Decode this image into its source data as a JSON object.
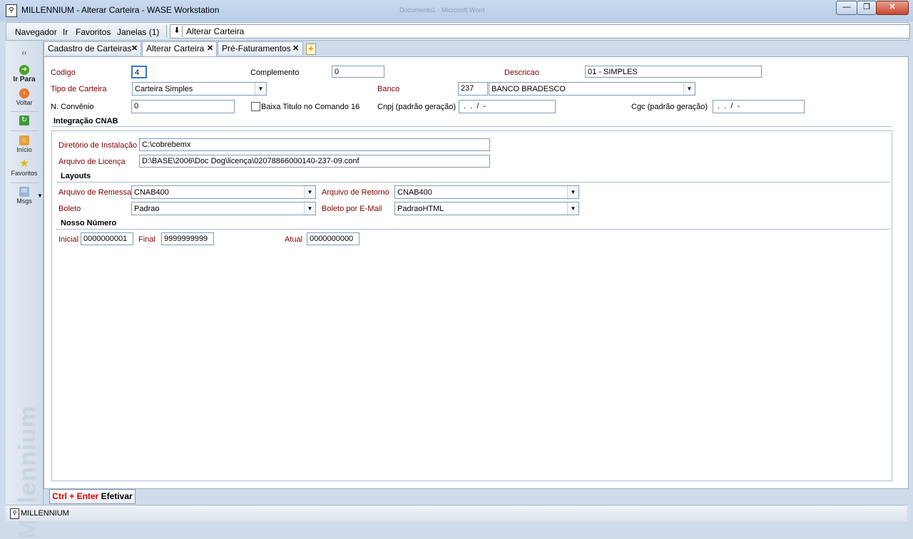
{
  "window": {
    "title": "MILLENNIUM - Alterar Carteira - WASE Workstation",
    "ghost_title": "Documento1 - Microsoft Word",
    "minimize": "—",
    "restore": "❐",
    "close": "✕"
  },
  "menu": {
    "items": [
      "Navegador",
      "Ir",
      "Favoritos",
      "Janelas (1)"
    ],
    "nav_arrow": "⬇",
    "nav_text": "Alterar Carteira"
  },
  "sidebar": {
    "collapse": "‹‹",
    "items": [
      {
        "label": "Ir Para",
        "icon": "go-arrow-icon"
      },
      {
        "label": "Voltar",
        "icon": "back-icon"
      },
      {
        "label": "",
        "icon": "refresh-icon"
      },
      {
        "label": "Início",
        "icon": "home-icon"
      },
      {
        "label": "Favoritos",
        "icon": "star-icon"
      },
      {
        "label": "Msgs",
        "icon": "messages-icon"
      }
    ],
    "watermark": "Millennium"
  },
  "tabs": [
    {
      "label": "Cadastro de Carteiras",
      "active": false
    },
    {
      "label": "Alterar Carteira",
      "active": true
    },
    {
      "label": "Pré-Faturamentos",
      "active": false
    }
  ],
  "form": {
    "codigo": {
      "label": "Codigo",
      "value": "4"
    },
    "complemento": {
      "label": "Complemento",
      "value": "0"
    },
    "descricao": {
      "label": "Descricao",
      "value": "01 - SIMPLES"
    },
    "tipo_carteira": {
      "label": "Tipo de Carteira",
      "value": "Carteira Simples"
    },
    "banco": {
      "label": "Banco",
      "code": "237",
      "name": "BANCO BRADESCO"
    },
    "convenio": {
      "label": "N. Convênio",
      "value": "0"
    },
    "baixa_titulo": {
      "label": "Baixa Titulo no Comando 16",
      "checked": false
    },
    "cnpj": {
      "label": "Cnpj (padrão geração)",
      "value": " .  .  /  -"
    },
    "cgc": {
      "label": "Cgc (padrão geração)",
      "value": " .  .  /  -"
    }
  },
  "cnab": {
    "section_title": "Integração CNAB",
    "diretorio": {
      "label": "Diretório de Instalação",
      "value": "C:\\cobrebemx"
    },
    "licenca": {
      "label": "Arquivo de Licença",
      "value": "D:\\BASE\\2006\\Doc Dog\\licença\\02078866000140-237-09.conf"
    },
    "layouts_title": "Layouts",
    "remessa": {
      "label": "Arquivo de Remessa",
      "value": "CNAB400"
    },
    "retorno": {
      "label": "Arquivo de Retorno",
      "value": "CNAB400"
    },
    "boleto": {
      "label": "Boleto",
      "value": "Padrao"
    },
    "boleto_email": {
      "label": "Boleto por E-Mail",
      "value": "PadraoHTML"
    },
    "nosso_numero_title": "Nosso Número",
    "inicial": {
      "label": "Inicial",
      "value": "0000000001"
    },
    "final": {
      "label": "Final",
      "value": "9999999999"
    },
    "atual": {
      "label": "Atual",
      "value": "0000000000"
    }
  },
  "actions": {
    "efetivar_shortcut": "Ctrl + Enter",
    "efetivar_label": "Efetivar"
  },
  "status": {
    "text": "MILLENNIUM"
  }
}
